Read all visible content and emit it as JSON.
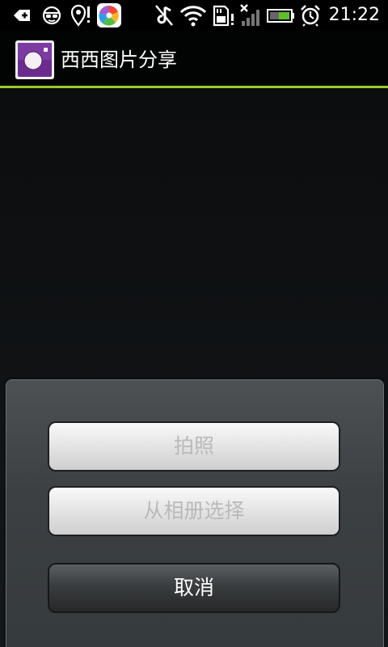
{
  "status_bar": {
    "time": "21:22",
    "icons": [
      "usb-debug-icon",
      "incognito-icon",
      "location-alert-icon",
      "app-notification-icon",
      "mute-icon",
      "wifi-icon",
      "sd-card-alert-icon",
      "no-signal-icon",
      "battery-charging-icon",
      "alarm-icon"
    ]
  },
  "app_bar": {
    "title": "西西图片分享",
    "icon": "camera-app-icon"
  },
  "colors": {
    "accent_line": "#9cc829",
    "app_icon_purple": "#6b2c8e"
  },
  "dialog": {
    "take_photo_label": "拍照",
    "choose_from_album_label": "从相册选择",
    "cancel_label": "取消"
  }
}
